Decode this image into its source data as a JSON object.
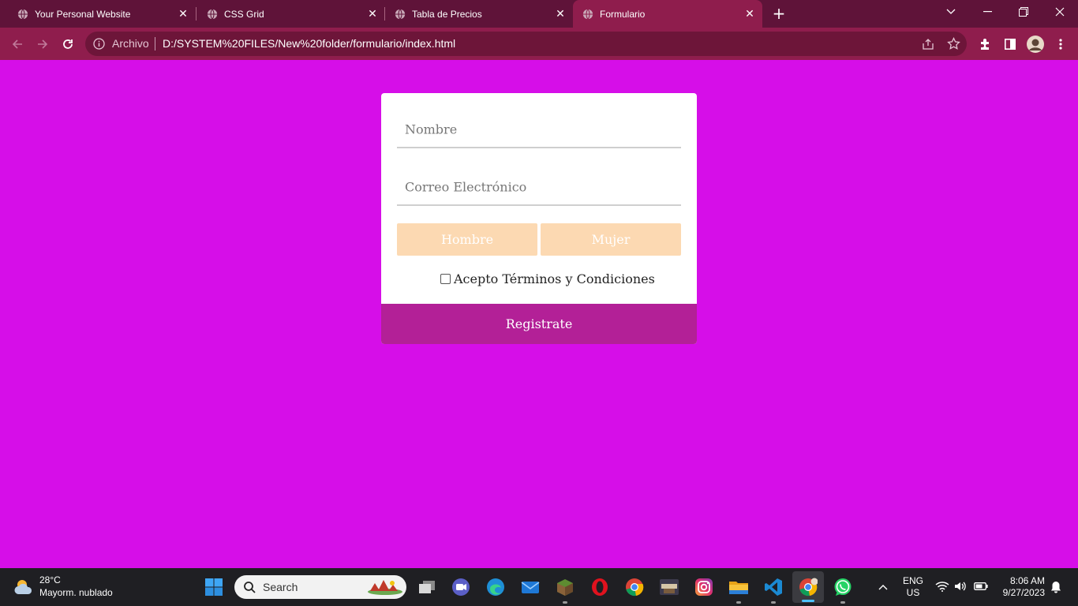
{
  "browser": {
    "tabs": [
      {
        "title": "Your Personal Website",
        "active": false
      },
      {
        "title": "CSS Grid",
        "active": false
      },
      {
        "title": "Tabla de Precios",
        "active": false
      },
      {
        "title": "Formulario",
        "active": true
      }
    ],
    "address": {
      "scheme_label": "Archivo",
      "url": "D:/SYSTEM%20FILES/New%20folder/formulario/index.html"
    }
  },
  "form": {
    "name_placeholder": "Nombre",
    "email_placeholder": "Correo Electrónico",
    "gender_male": "Hombre",
    "gender_female": "Mujer",
    "terms_label": "Acepto Términos y Condiciones",
    "terms_checked": false,
    "submit_label": "Registrate"
  },
  "taskbar": {
    "weather_temp": "28°C",
    "weather_condition": "Mayorm. nublado",
    "search_placeholder": "Search",
    "language": "ENG",
    "region": "US",
    "time": "8:06 AM",
    "date": "9/27/2023"
  },
  "colors": {
    "page_bg": "#d60ee8",
    "tab_strip": "#5f1339",
    "toolbar": "#8f1d4d",
    "gender_button": "#fcd9b2",
    "submit_button": "#b32097"
  }
}
